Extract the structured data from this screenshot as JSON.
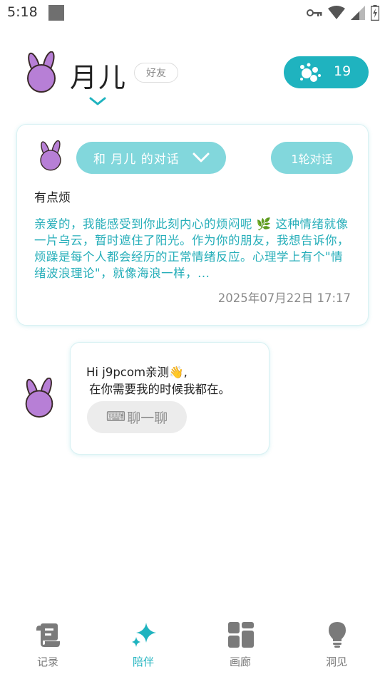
{
  "status_bar": {
    "time": "5:18",
    "icons": [
      "key-icon",
      "wifi-icon",
      "signal-icon",
      "battery-icon"
    ]
  },
  "header": {
    "name": "月儿",
    "relation": "好友",
    "points": "19"
  },
  "conversation": {
    "selector_label": "和 月儿 的对话",
    "rounds_label": "1轮对话",
    "user_message": "有点烦",
    "ai_message": "亲爱的，我能感受到你此刻内心的烦闷呢 🌿 这种情绪就像一片乌云，暂时遮住了阳光。作为你的朋友，我想告诉你，烦躁是每个人都会经历的正常情绪反应。心理学上有个\"情绪波浪理论\"，就像海浪一样，...",
    "date": "2025年07月22日 17:17"
  },
  "greeting": {
    "line1": "Hi j9pcom亲测👋,",
    "line2": "在你需要我的时候我都在。",
    "button_icon": "⌨",
    "button_label": "聊一聊"
  },
  "nav": {
    "items": [
      {
        "label": "记录",
        "icon": "scroll-icon",
        "active": false
      },
      {
        "label": "陪伴",
        "icon": "sparkle-icon",
        "active": true
      },
      {
        "label": "画廊",
        "icon": "gallery-icon",
        "active": false
      },
      {
        "label": "洞见",
        "icon": "bulb-icon",
        "active": false
      }
    ]
  },
  "colors": {
    "accent": "#1fb3bf",
    "accent_light": "#82d7dc",
    "avatar": "#b77fd6"
  }
}
